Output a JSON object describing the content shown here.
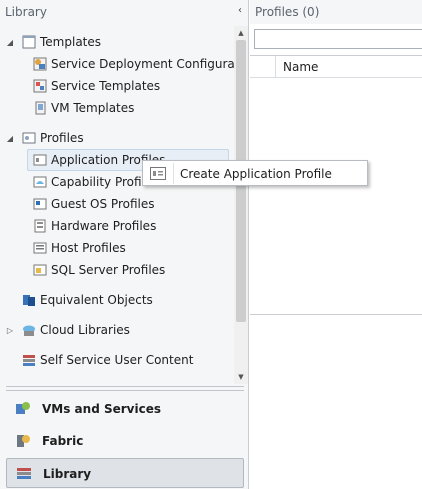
{
  "left_pane": {
    "header": "Library",
    "collapse_glyph": "‹"
  },
  "tree": {
    "templates": {
      "label": "Templates",
      "expander": "◢",
      "children": [
        {
          "label": "Service Deployment Configuratio",
          "icon": "service-deployment-icon"
        },
        {
          "label": "Service Templates",
          "icon": "service-template-icon"
        },
        {
          "label": "VM Templates",
          "icon": "vm-template-icon"
        }
      ]
    },
    "profiles": {
      "label": "Profiles",
      "expander": "◢",
      "children": [
        {
          "label": "Application Profiles",
          "icon": "application-profile-icon"
        },
        {
          "label": "Capability Profiles",
          "icon": "capability-profile-icon"
        },
        {
          "label": "Guest OS Profiles",
          "icon": "guest-os-profile-icon"
        },
        {
          "label": "Hardware Profiles",
          "icon": "hardware-profile-icon"
        },
        {
          "label": "Host Profiles",
          "icon": "host-profile-icon"
        },
        {
          "label": "SQL Server Profiles",
          "icon": "sql-server-profile-icon"
        }
      ]
    },
    "equivalent_objects": {
      "label": "Equivalent Objects"
    },
    "cloud_libraries": {
      "label": "Cloud Libraries",
      "expander": "▷"
    },
    "self_service": {
      "label": "Self Service User Content"
    }
  },
  "scrollbar": {
    "up": "▲",
    "down": "▼"
  },
  "workspaces": [
    {
      "label": "VMs and Services",
      "icon": "vms-services-icon"
    },
    {
      "label": "Fabric",
      "icon": "fabric-icon"
    },
    {
      "label": "Library",
      "icon": "library-icon",
      "active": true
    }
  ],
  "right_pane": {
    "header": "Profiles (0)",
    "search_placeholder": "",
    "columns": [
      "Name"
    ]
  },
  "context_menu": {
    "items": [
      {
        "label": "Create Application Profile",
        "icon": "create-profile-icon"
      }
    ]
  },
  "colors": {
    "pane_bg": "#f5f6f7",
    "selection_bg": "#e8eef6",
    "header_text": "#5a6470"
  }
}
